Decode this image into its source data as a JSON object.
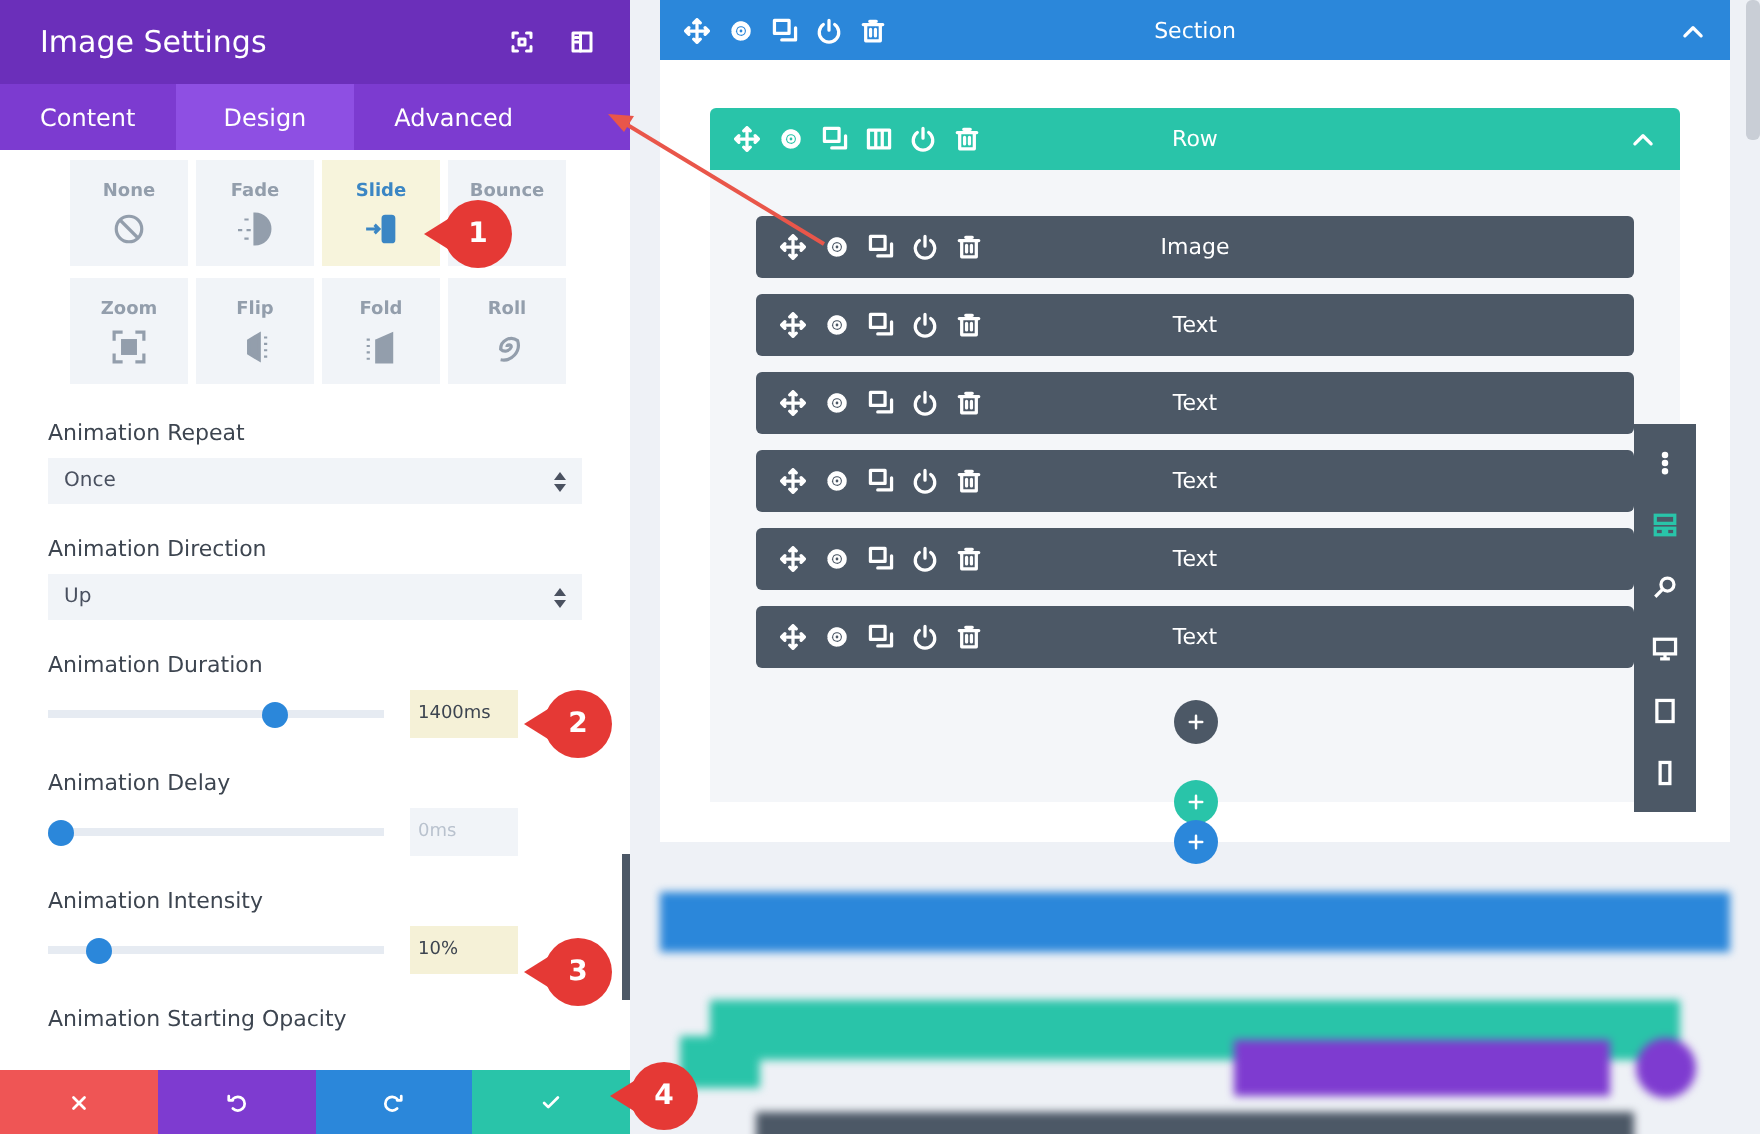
{
  "panel": {
    "title": "Image Settings",
    "tabs": [
      {
        "label": "Content",
        "selected": false
      },
      {
        "label": "Design",
        "selected": true
      },
      {
        "label": "Advanced",
        "selected": false
      }
    ],
    "animation_styles": [
      {
        "label": "None",
        "selected": false
      },
      {
        "label": "Fade",
        "selected": false
      },
      {
        "label": "Slide",
        "selected": true
      },
      {
        "label": "Bounce",
        "selected": false,
        "icon_covered": true
      },
      {
        "label": "Zoom",
        "selected": false
      },
      {
        "label": "Flip",
        "selected": false
      },
      {
        "label": "Fold",
        "selected": false
      },
      {
        "label": "Roll",
        "selected": false
      }
    ],
    "fields": [
      {
        "kind": "select",
        "label": "Animation Repeat",
        "value": "Once"
      },
      {
        "kind": "select",
        "label": "Animation Direction",
        "value": "Up"
      },
      {
        "kind": "slider",
        "label": "Animation Duration",
        "level": 0.69,
        "value": "1400ms",
        "modified": true
      },
      {
        "kind": "slider",
        "label": "Animation Delay",
        "level": 0,
        "placeholder": "0ms",
        "modified": false
      },
      {
        "kind": "slider",
        "label": "Animation Intensity",
        "level": 0.12,
        "value": "10%",
        "modified": true
      }
    ],
    "cut_label": "Animation Starting Opacity"
  },
  "builder": {
    "section": {
      "title": "Section"
    },
    "row": {
      "title": "Row"
    },
    "modules": [
      {
        "title": "Image"
      },
      {
        "title": "Text"
      },
      {
        "title": "Text"
      },
      {
        "title": "Text"
      },
      {
        "title": "Text"
      },
      {
        "title": "Text"
      }
    ]
  },
  "view_modes": [
    {
      "selected": false
    },
    {
      "selected": true
    },
    {
      "selected": false
    },
    {
      "selected": false
    },
    {
      "selected": false
    },
    {
      "selected": false
    }
  ],
  "callouts": [
    "1",
    "2",
    "3",
    "4"
  ]
}
